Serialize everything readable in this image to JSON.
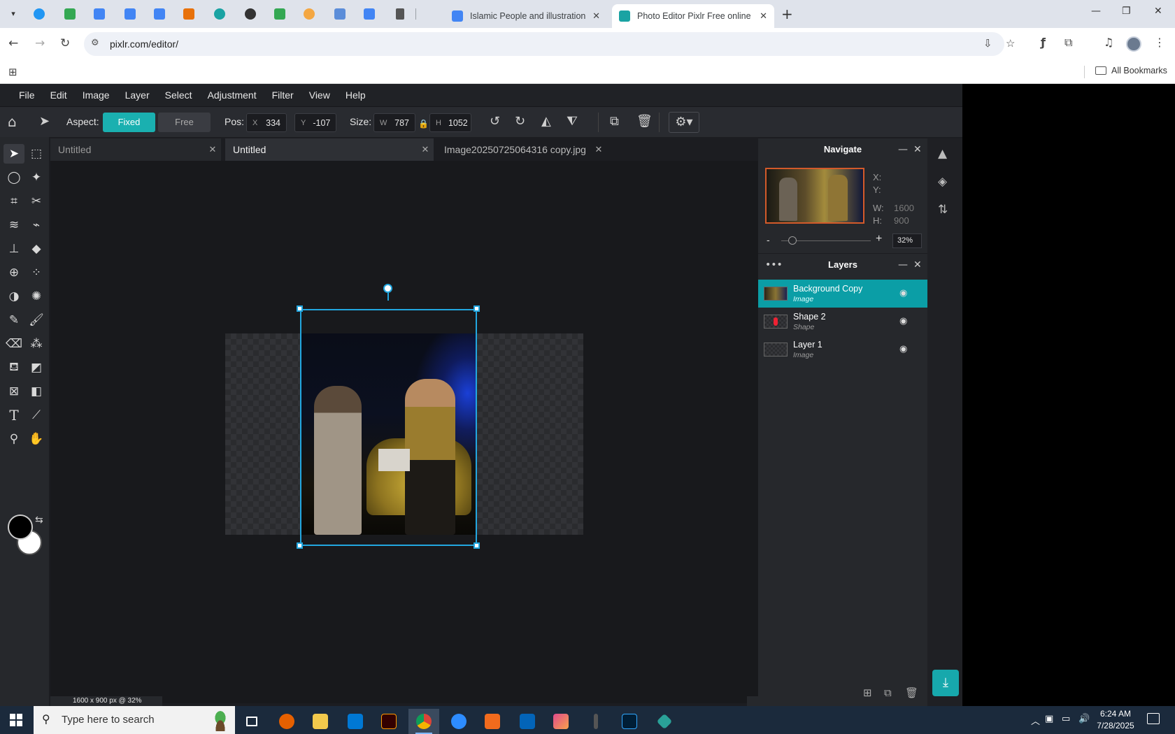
{
  "browser": {
    "pinned_tab_colors": [
      "#2196f3",
      "#34a853",
      "#4285f4",
      "#4285f4",
      "#4285f4",
      "#e8710a",
      "#1aa3a3",
      "#333333",
      "#34a853",
      "#f4a742",
      "#5b8dd9",
      "#4285f4",
      "#555555"
    ],
    "tabs": [
      {
        "title": "Islamic People and illustration v",
        "favicon_color": "#4285f4"
      },
      {
        "title": "Photo Editor Pixlr Free online Im",
        "favicon_color": "#1aa3a3"
      }
    ],
    "url": "pixlr.com/editor/",
    "all_bookmarks": "All Bookmarks"
  },
  "pixlr": {
    "menu": [
      "File",
      "Edit",
      "Image",
      "Layer",
      "Select",
      "Adjustment",
      "Filter",
      "View",
      "Help"
    ],
    "options": {
      "aspect_label": "Aspect:",
      "fixed": "Fixed",
      "free": "Free",
      "pos_label": "Pos:",
      "x_key": "X",
      "x": "334",
      "y_key": "Y",
      "y": "-107",
      "size_label": "Size:",
      "w_key": "W",
      "w": "787",
      "h_key": "H",
      "h": "1052"
    },
    "doc_tabs": [
      "Untitled",
      "Untitled",
      "Image20250725064316 copy.jpg"
    ],
    "status": "1600 x 900 px @ 32%",
    "navigate": {
      "title": "Navigate",
      "x_label": "X:",
      "y_label": "Y:",
      "w_label": "W:",
      "w": "1600",
      "h_label": "H:",
      "h": "900",
      "zoom_minus": "-",
      "zoom_plus": "+",
      "zoom": "32%"
    },
    "layers": {
      "title": "Layers",
      "items": [
        {
          "name": "Background Copy",
          "type": "Image",
          "selected": true
        },
        {
          "name": "Shape 2",
          "type": "Shape",
          "selected": false
        },
        {
          "name": "Layer 1",
          "type": "Image",
          "selected": false
        }
      ]
    },
    "accent_color": "#1ab0b0",
    "selection_color": "#22a7e0"
  },
  "taskbar": {
    "search_placeholder": "Type here to search",
    "time": "6:24 AM",
    "date": "7/28/2025",
    "app_colors": [
      "#e66000",
      "#f2c94c",
      "#0078d4",
      "#330000",
      "#4285f4",
      "#2d8cff",
      "#f26b1d",
      "#0364b8",
      "#e04a8c",
      "#555555",
      "#001e36",
      "#2aa198"
    ]
  }
}
